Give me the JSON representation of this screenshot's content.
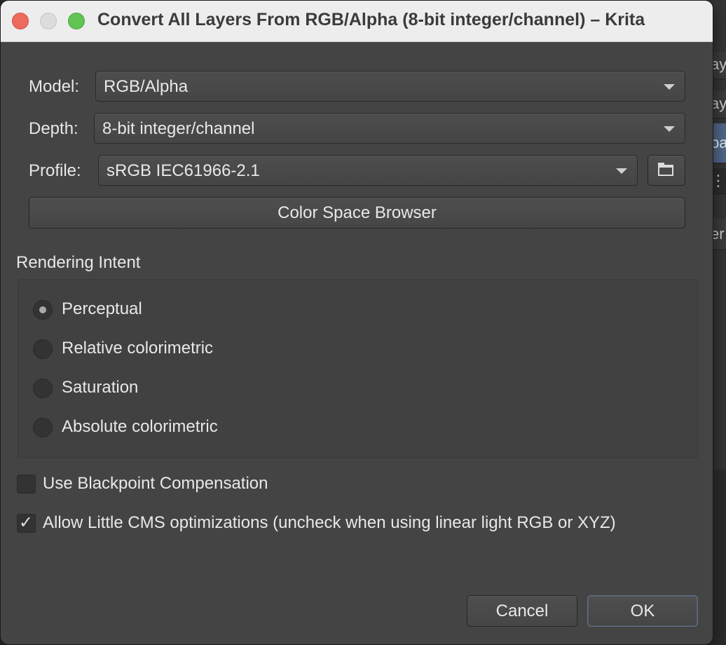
{
  "window": {
    "title": "Convert All Layers From RGB/Alpha (8-bit integer/channel) – Krita"
  },
  "color_space": {
    "model_label": "Model:",
    "model_value": "RGB/Alpha",
    "depth_label": "Depth:",
    "depth_value": "8-bit integer/channel",
    "profile_label": "Profile:",
    "profile_value": "sRGB IEC61966-2.1",
    "profile_browse_icon": "folder-icon",
    "browser_button": "Color Space Browser"
  },
  "rendering_intent": {
    "heading": "Rendering Intent",
    "options": [
      {
        "label": "Perceptual",
        "checked": true
      },
      {
        "label": "Relative colorimetric",
        "checked": false
      },
      {
        "label": "Saturation",
        "checked": false
      },
      {
        "label": "Absolute colorimetric",
        "checked": false
      }
    ]
  },
  "options": {
    "blackpoint_label": "Use Blackpoint Compensation",
    "blackpoint_checked": false,
    "lcms_label": "Allow Little CMS optimizations (uncheck when using linear light RGB or XYZ)",
    "lcms_checked": true
  },
  "buttons": {
    "cancel": "Cancel",
    "ok": "OK"
  },
  "background_app": {
    "fragments": [
      "ay",
      "ay",
      "pa",
      "⋮",
      "er"
    ]
  },
  "colors": {
    "dialog_bg": "#444444",
    "titlebar_bg": "#ededed",
    "selection_blue": "#51688a",
    "close": "#ed6a5e",
    "maximize": "#61c554"
  }
}
